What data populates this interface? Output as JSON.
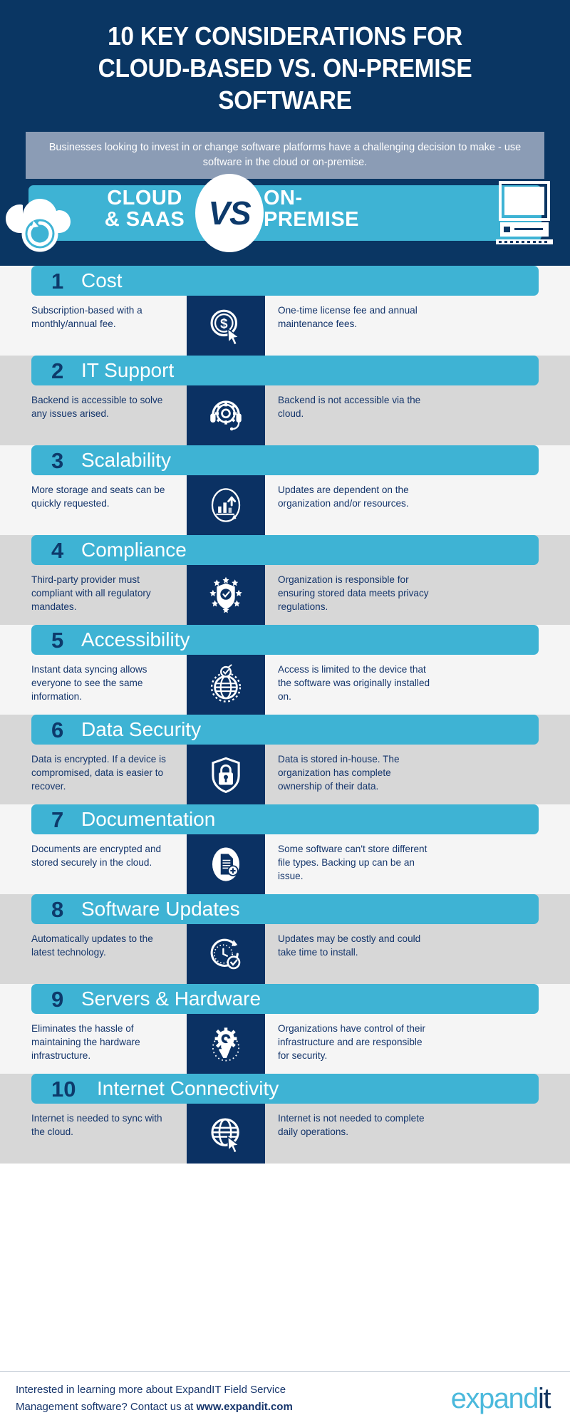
{
  "header": {
    "title_lines": [
      "10 KEY CONSIDERATIONS FOR",
      "CLOUD-BASED VS. ON-PREMISE",
      "SOFTWARE"
    ],
    "subtitle": "Businesses looking to invest in or change software platforms have a challenging decision to make - use software in the cloud or on-premise."
  },
  "vs_band": {
    "left_label_line1": "CLOUD",
    "left_label_line2": "& SAAS",
    "vs_label": "VS",
    "right_label_line1": "ON-",
    "right_label_line2": "PREMISE",
    "left_icon": "cloud-sync-icon",
    "right_icon": "desktop-computer-icon"
  },
  "colors": {
    "navy": "#0a3663",
    "teal": "#3eb3d4",
    "icon_panel": "#0b3163",
    "stripe_light": "#f5f5f5",
    "stripe_dark": "#d7d7d7",
    "subtitle_box": "#8b9cb5",
    "body_text": "#14356b"
  },
  "rows": [
    {
      "number": "1",
      "name": "Cost",
      "icon": "dollar-coin-cursor-icon",
      "cloud": "Subscription-based with a monthly/annual fee.",
      "onprem": "One-time license fee and annual maintenance fees."
    },
    {
      "number": "2",
      "name": "IT Support",
      "icon": "headset-gear-icon",
      "cloud": "Backend is accessible to solve any issues arised.",
      "onprem": "Backend is not accessible via the cloud."
    },
    {
      "number": "3",
      "name": "Scalability",
      "icon": "growth-chart-arrow-icon",
      "cloud": "More storage and seats can be quickly requested.",
      "onprem": "Updates are dependent on the organization and/or resources."
    },
    {
      "number": "4",
      "name": "Compliance",
      "icon": "shield-stars-check-icon",
      "cloud": "Third-party provider must compliant with all regulatory mandates.",
      "onprem": "Organization is responsible for ensuring stored data meets privacy regulations."
    },
    {
      "number": "5",
      "name": "Accessibility",
      "icon": "globe-check-icon",
      "cloud": "Instant data syncing allows everyone to see the same information.",
      "onprem": "Access is limited to the device that the software was originally installed on."
    },
    {
      "number": "6",
      "name": "Data Security",
      "icon": "shield-padlock-icon",
      "cloud": "Data is encrypted. If a device is compromised, data is easier to recover.",
      "onprem": "Data is stored in-house. The organization has complete ownership of their data."
    },
    {
      "number": "7",
      "name": "Documentation",
      "icon": "document-plus-icon",
      "cloud": "Documents are encrypted and  stored securely in the cloud.",
      "onprem": "Some software can't store different file types. Backing up can be an issue."
    },
    {
      "number": "8",
      "name": "Software Updates",
      "icon": "clock-refresh-check-icon",
      "cloud": "Automatically updates to the latest technology.",
      "onprem": "Updates may be costly and could take time to install."
    },
    {
      "number": "9",
      "name": "Servers & Hardware",
      "icon": "gear-wrench-icon",
      "cloud": "Eliminates the hassle of maintaining the hardware infrastructure.",
      "onprem": "Organizations have control of their infrastructure and are responsible for security."
    },
    {
      "number": "10",
      "name": "Internet Connectivity",
      "icon": "globe-cursor-icon",
      "cloud": "Internet is needed to sync with the cloud.",
      "onprem": "Internet is not needed to complete daily operations."
    }
  ],
  "footer": {
    "line1": "Interested in learning more about ExpandIT Field Service",
    "line2_prefix": "Management software? Contact us at ",
    "line2_bold": "www.expandit.com",
    "logo_part1": "expand",
    "logo_part2": "it"
  }
}
